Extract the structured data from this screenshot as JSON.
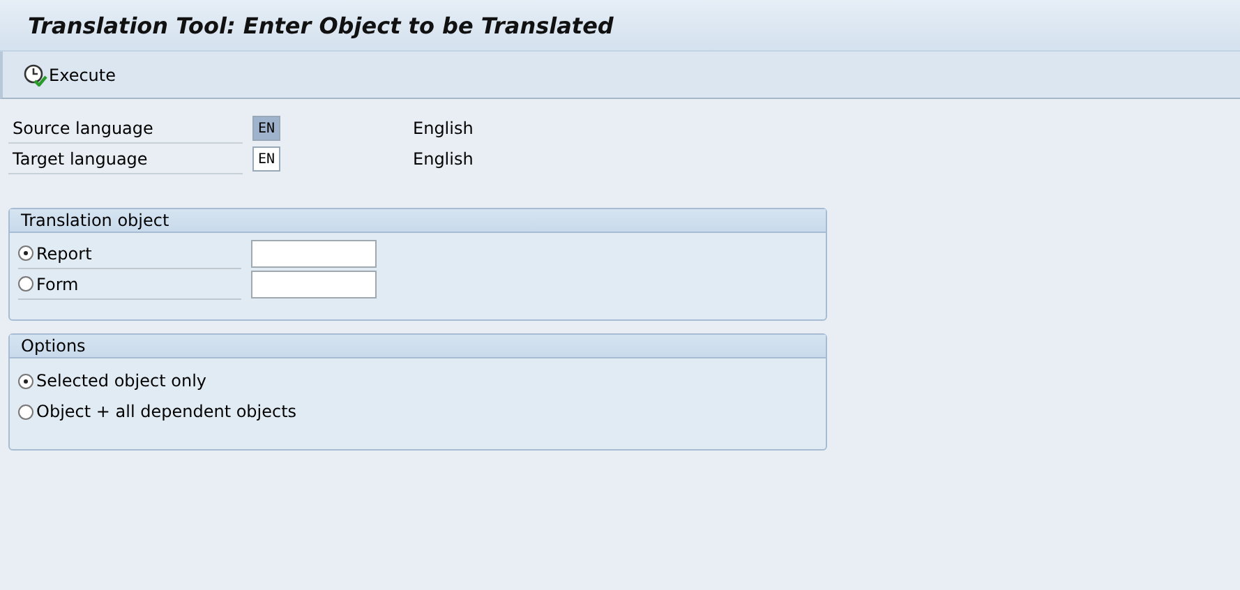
{
  "window": {
    "title": "Translation Tool: Enter Object to be Translated"
  },
  "toolbar": {
    "buttons": [
      {
        "label": "Execute"
      }
    ]
  },
  "languages": [
    {
      "label": "Source language",
      "value": "EN",
      "description": "English",
      "highlighted": true
    },
    {
      "label": "Target language",
      "value": "EN",
      "description": "English",
      "highlighted": false
    }
  ],
  "translation_object": {
    "title": "Translation object",
    "options": [
      {
        "label": "Report",
        "selected": true
      },
      {
        "label": "Form",
        "selected": false
      }
    ]
  },
  "options": {
    "title": "Options",
    "options": [
      {
        "label": "Selected object only",
        "selected": true
      },
      {
        "label": "Object + all dependent objects",
        "selected": false
      }
    ]
  }
}
